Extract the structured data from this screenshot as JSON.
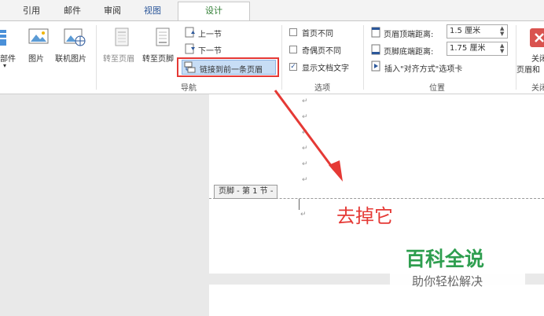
{
  "tabs": {
    "cite": "引用",
    "mail": "邮件",
    "review": "审阅",
    "view": "视图",
    "design": "设计"
  },
  "insert_group": {
    "parts": "部件",
    "picture": "图片",
    "online_picture": "联机图片"
  },
  "nav_group": {
    "goto_header": "转至页眉",
    "goto_footer": "转至页脚",
    "prev": "上一节",
    "next": "下一节",
    "link_prev": "链接到前一条页眉",
    "group_label": "导航"
  },
  "options_group": {
    "first_page": "首页不同",
    "odd_even": "奇偶页不同",
    "show_text": "显示文档文字",
    "group_label": "选项",
    "checked": {
      "first_page": false,
      "odd_even": false,
      "show_text": true
    }
  },
  "position_group": {
    "header_top_label": "页眉顶端距离:",
    "header_top_value": "1.5 厘米",
    "footer_bottom_label": "页脚底端距离:",
    "footer_bottom_value": "1.75 厘米",
    "insert_align_tab": "插入\"对齐方式\"选项卡",
    "group_label": "位置"
  },
  "close_group": {
    "label_line1": "关闭",
    "label_line2": "页眉和",
    "group_label": "关闭"
  },
  "document": {
    "para_mark": "↵",
    "footer_tag": "页脚 - 第 1 节 -",
    "annotation": "去掉它"
  },
  "watermark": {
    "title": "百科全说",
    "subtitle": "助你轻松解决"
  },
  "colors": {
    "accent_green": "#2e7d32",
    "highlight_box": "#e53935",
    "annotation": "#e53935",
    "watermark_green": "#2e9e4f"
  }
}
